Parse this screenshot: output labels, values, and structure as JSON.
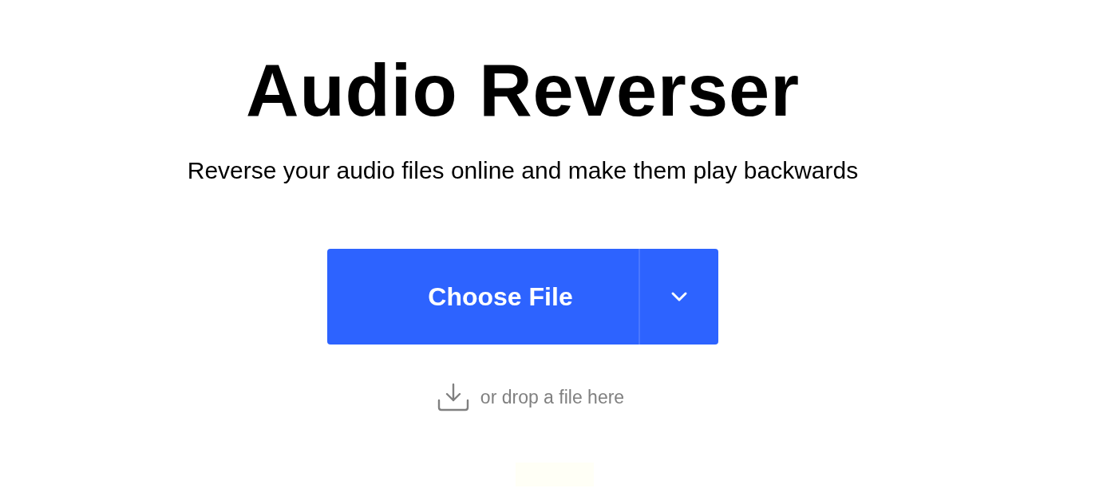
{
  "title": "Audio Reverser",
  "subtitle": "Reverse your audio files online and make them play backwards",
  "upload": {
    "button": "Choose File",
    "drop_hint": "or drop a file here"
  }
}
